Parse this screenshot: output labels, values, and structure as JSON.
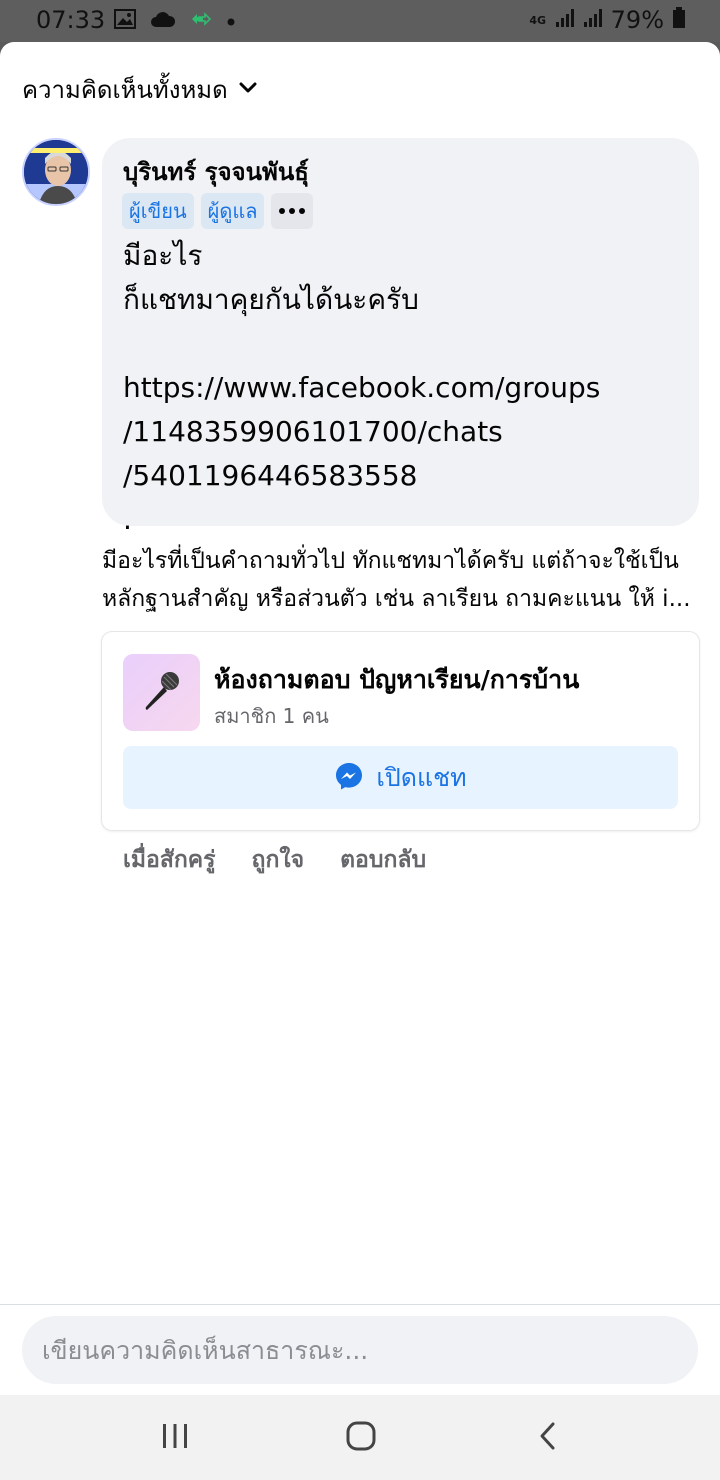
{
  "status_bar": {
    "time": "07:33",
    "network": "4G",
    "battery": "79%",
    "icons": [
      "image-icon",
      "cloud-icon",
      "sync-icon",
      "dot-icon",
      "signal-icon",
      "signal-icon",
      "battery-icon"
    ]
  },
  "header": {
    "filter_label": "ความคิดเห็นทั้งหมด",
    "filter_icon": "chevron-down-icon"
  },
  "comment": {
    "author": "บุรินทร์ รุจจนพันธุ์",
    "badges": [
      "ผู้เขียน",
      "ผู้ดูแล"
    ],
    "more_icon": "more-horizontal-icon",
    "text": "มีอะไร\nก็แชทมาคุยกันได้นะครับ\n\nhttps://www.facebook.com/groups\n/1148359906101700/chats\n/5401196446583558\n."
  },
  "preview": {
    "line1": "มีอะไรที่เป็นคำถามทั่วไป ทักแชทมาได้ครับ แต่ถ้าจะใช้เป็น",
    "line2": "หลักฐานสำคัญ หรือส่วนตัว เช่น ลาเรียน ถามคะแนน ให้ i..."
  },
  "chat_card": {
    "title": "ห้องถามตอบ ปัญหาเรียน/การบ้าน",
    "subtitle": "สมาชิก 1 คน",
    "button_label": "เปิดแชท",
    "thumb_icon": "microphone-icon",
    "button_icon": "messenger-icon"
  },
  "actions": {
    "time": "เมื่อสักครู่",
    "like": "ถูกใจ",
    "reply": "ตอบกลับ"
  },
  "composer": {
    "placeholder": "เขียนความคิดเห็นสาธารณะ...",
    "value": ""
  },
  "nav_bar": {
    "icons": [
      "recent-apps-icon",
      "home-icon",
      "back-icon"
    ]
  },
  "colors": {
    "accent": "#1b74e4",
    "bubble": "#f0f2f5",
    "secondary_text": "#65676b"
  }
}
